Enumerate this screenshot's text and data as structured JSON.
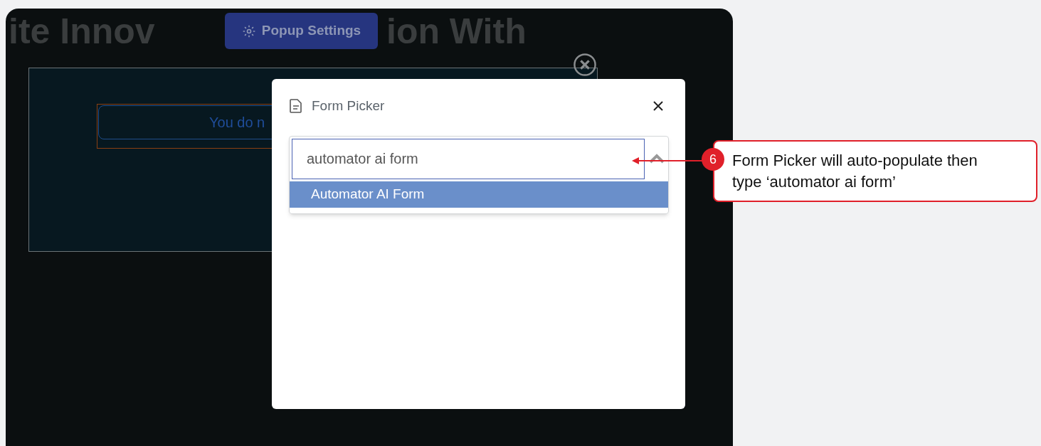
{
  "background_page": {
    "headline_parts": [
      "ite Innov",
      "ion With"
    ],
    "settings_button": {
      "label": "Popup Settings"
    },
    "popup": {
      "message": "You do n"
    }
  },
  "form_picker": {
    "title": "Form Picker",
    "search": {
      "value": "automator ai form",
      "expanded": true
    },
    "options": [
      {
        "label": "Automator AI Form",
        "selected": true
      }
    ]
  },
  "annotation": {
    "step": "6",
    "text": "Form Picker will auto-populate then type ‘automator ai form’"
  }
}
